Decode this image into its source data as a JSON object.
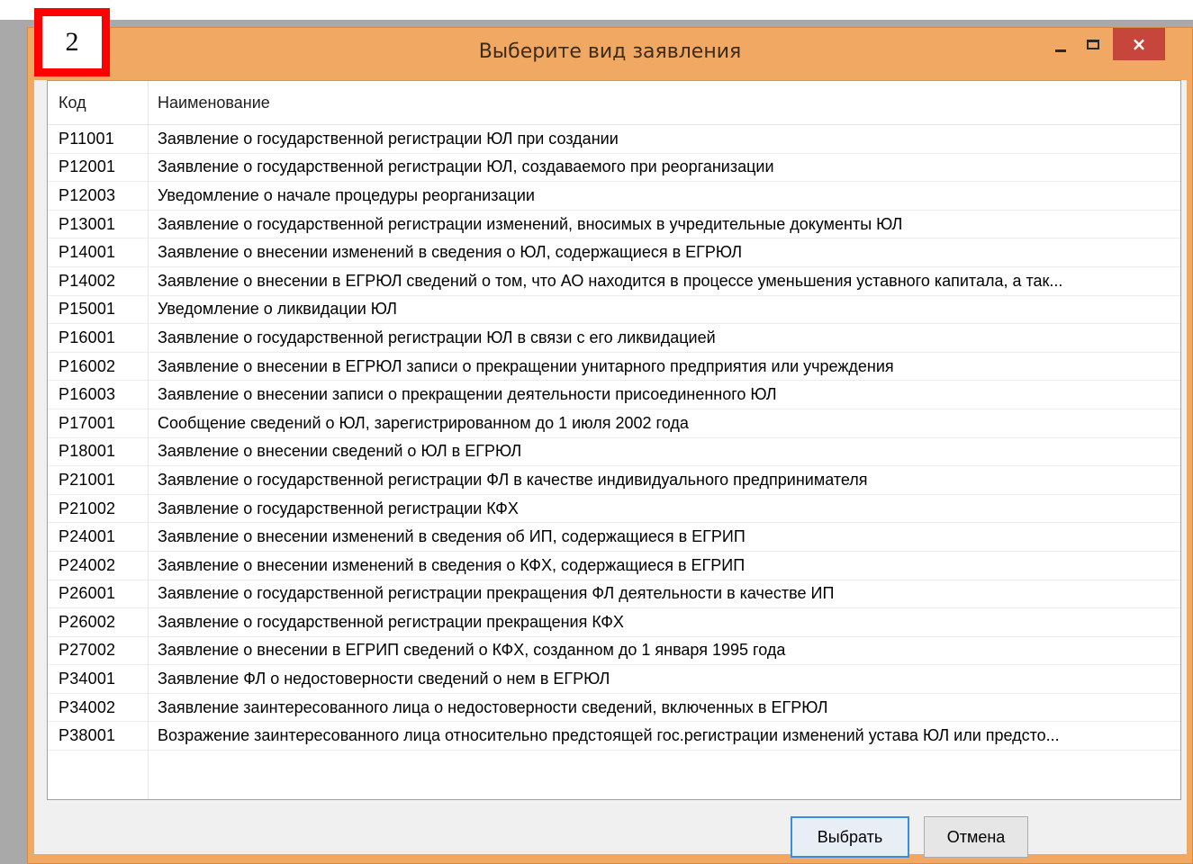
{
  "window": {
    "title": "Выберите вид заявления",
    "close_glyph": "×"
  },
  "badge": {
    "label": "2"
  },
  "grid": {
    "columns": [
      "Код",
      "Наименование"
    ],
    "rows": [
      [
        "P11001",
        "Заявление о государственной регистрации ЮЛ при создании"
      ],
      [
        "P12001",
        "Заявление о государственной регистрации ЮЛ, создаваемого при реорганизации"
      ],
      [
        "P12003",
        "Уведомление о начале процедуры реорганизации"
      ],
      [
        "P13001",
        "Заявление о государственной регистрации изменений, вносимых в учредительные документы ЮЛ"
      ],
      [
        "P14001",
        "Заявление о внесении изменений в сведения о ЮЛ, содержащиеся в ЕГРЮЛ"
      ],
      [
        "P14002",
        "Заявление о внесении в ЕГРЮЛ сведений о том, что АО находится в процессе уменьшения уставного капитала, а так..."
      ],
      [
        "P15001",
        "Уведомление о ликвидации ЮЛ"
      ],
      [
        "P16001",
        "Заявление о государственной регистрации ЮЛ в связи с его ликвидацией"
      ],
      [
        "P16002",
        "Заявление о внесении в ЕГРЮЛ записи о прекращении унитарного предприятия или учреждения"
      ],
      [
        "P16003",
        "Заявление о внесении записи о прекращении деятельности присоединенного ЮЛ"
      ],
      [
        "P17001",
        "Сообщение сведений о ЮЛ, зарегистрированном до 1 июля 2002 года"
      ],
      [
        "P18001",
        "Заявление о внесении сведений о ЮЛ в ЕГРЮЛ"
      ],
      [
        "P21001",
        "Заявление о государственной регистрации ФЛ в качестве индивидуального предпринимателя"
      ],
      [
        "P21002",
        "Заявление о государственной регистрации КФХ"
      ],
      [
        "P24001",
        "Заявление о внесении изменений в сведения об ИП, содержащиеся в ЕГРИП"
      ],
      [
        "P24002",
        "Заявление о внесении изменений в сведения о КФХ, содержащиеся в ЕГРИП"
      ],
      [
        "P26001",
        "Заявление о государственной регистрации прекращения ФЛ деятельности в качестве ИП"
      ],
      [
        "P26002",
        "Заявление о государственной регистрации прекращения КФХ"
      ],
      [
        "P27002",
        "Заявление о внесении в ЕГРИП сведений о КФХ, созданном до 1 января 1995 года"
      ],
      [
        "P34001",
        "Заявление ФЛ о недостоверности сведений о нем в ЕГРЮЛ"
      ],
      [
        "P34002",
        "Заявление заинтересованного лица о недостоверности сведений, включенных в ЕГРЮЛ"
      ],
      [
        "P38001",
        "Возражение заинтересованного лица относительно предстоящей гос.регистрации изменений устава ЮЛ или предсто..."
      ]
    ]
  },
  "buttons": {
    "ok_label": "Выбрать",
    "cancel_label": "Отмена"
  },
  "colors": {
    "frame": "#f0a862",
    "close": "#c7463c",
    "badge_border": "#ff0000",
    "focus": "#3c8ce0"
  }
}
